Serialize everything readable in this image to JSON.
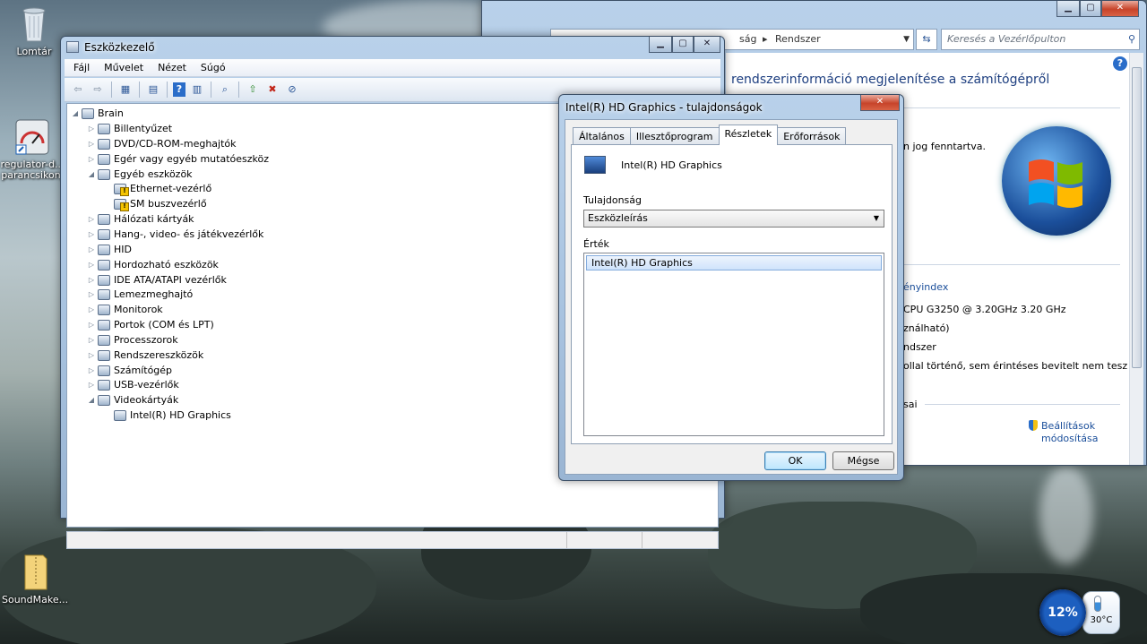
{
  "desktop": {
    "icons": [
      {
        "label": "Lomtár",
        "icon": "recycle-bin"
      },
      {
        "label": "regulator-d...\nparancsikonj",
        "icon": "shortcut"
      },
      {
        "label": "SoundMake...",
        "icon": "zip-folder"
      }
    ]
  },
  "system_window": {
    "breadcrumb_part": "ság",
    "breadcrumb_sep": "▸",
    "breadcrumb_current": "Rendszer",
    "search_placeholder": "Keresés a Vezérlőpulton",
    "heading": "rendszerinformáció megjelenítése a számítógépről",
    "rights_text": "n jog fenntartva.",
    "perf_link": "ényindex",
    "cpu": "CPU G3250 @ 3.20GHz   3.20 GHz",
    "ram_note": "ználható)",
    "system_type": "ndszer",
    "pen_touch": "ollal történő, sem érintéses bevitelt nem tesz",
    "section_label": "sai",
    "settings_link_1": "Beállítások",
    "settings_link_2": "módosítása",
    "help_icon": "?"
  },
  "device_manager": {
    "title": "Eszközkezelő",
    "menu": [
      "Fájl",
      "Művelet",
      "Nézet",
      "Súgó"
    ],
    "toolbar_icons": [
      "back-arrow",
      "forward-arrow",
      "properties-grid",
      "view-list",
      "help",
      "view-details",
      "scan-hardware",
      "update-driver",
      "uninstall",
      "disable"
    ],
    "tree": {
      "root": "Brain",
      "items": [
        {
          "label": "Billentyűzet",
          "level": 1,
          "expander": "▷"
        },
        {
          "label": "DVD/CD-ROM-meghajtók",
          "level": 1,
          "expander": "▷"
        },
        {
          "label": "Egér vagy egyéb mutatóeszköz",
          "level": 1,
          "expander": "▷"
        },
        {
          "label": "Egyéb eszközök",
          "level": 1,
          "expander": "◢"
        },
        {
          "label": "Ethernet-vezérlő",
          "level": 2,
          "expander": "",
          "warn": true
        },
        {
          "label": "SM buszvezérlő",
          "level": 2,
          "expander": "",
          "warn": true
        },
        {
          "label": "Hálózati kártyák",
          "level": 1,
          "expander": "▷"
        },
        {
          "label": "Hang-, video- és játékvezérlők",
          "level": 1,
          "expander": "▷"
        },
        {
          "label": "HID",
          "level": 1,
          "expander": "▷"
        },
        {
          "label": "Hordozható eszközök",
          "level": 1,
          "expander": "▷"
        },
        {
          "label": "IDE ATA/ATAPI vezérlők",
          "level": 1,
          "expander": "▷"
        },
        {
          "label": "Lemezmeghajtó",
          "level": 1,
          "expander": "▷"
        },
        {
          "label": "Monitorok",
          "level": 1,
          "expander": "▷"
        },
        {
          "label": "Portok (COM és LPT)",
          "level": 1,
          "expander": "▷"
        },
        {
          "label": "Processzorok",
          "level": 1,
          "expander": "▷"
        },
        {
          "label": "Rendszereszközök",
          "level": 1,
          "expander": "▷"
        },
        {
          "label": "Számítógép",
          "level": 1,
          "expander": "▷"
        },
        {
          "label": "USB-vezérlők",
          "level": 1,
          "expander": "▷"
        },
        {
          "label": "Videokártyák",
          "level": 1,
          "expander": "◢"
        },
        {
          "label": "Intel(R) HD Graphics",
          "level": 2,
          "expander": ""
        }
      ]
    }
  },
  "properties_dialog": {
    "title": "Intel(R) HD Graphics - tulajdonságok",
    "tabs": [
      "Általános",
      "Illesztőprogram",
      "Részletek",
      "Erőforrások"
    ],
    "active_tab": "Részletek",
    "device_name": "Intel(R) HD Graphics",
    "property_label": "Tulajdonság",
    "property_value": "Eszközleírás",
    "value_label": "Érték",
    "value_item": "Intel(R) HD Graphics",
    "ok_label": "OK",
    "cancel_label": "Mégse"
  },
  "gadget": {
    "cpu_percent": "12%",
    "temperature": "30°C"
  },
  "colors": {
    "window_frame": "#a7c2df",
    "link": "#1a4e9a",
    "close_button": "#c7442a",
    "gadget_blue": "#1d5fbf"
  }
}
